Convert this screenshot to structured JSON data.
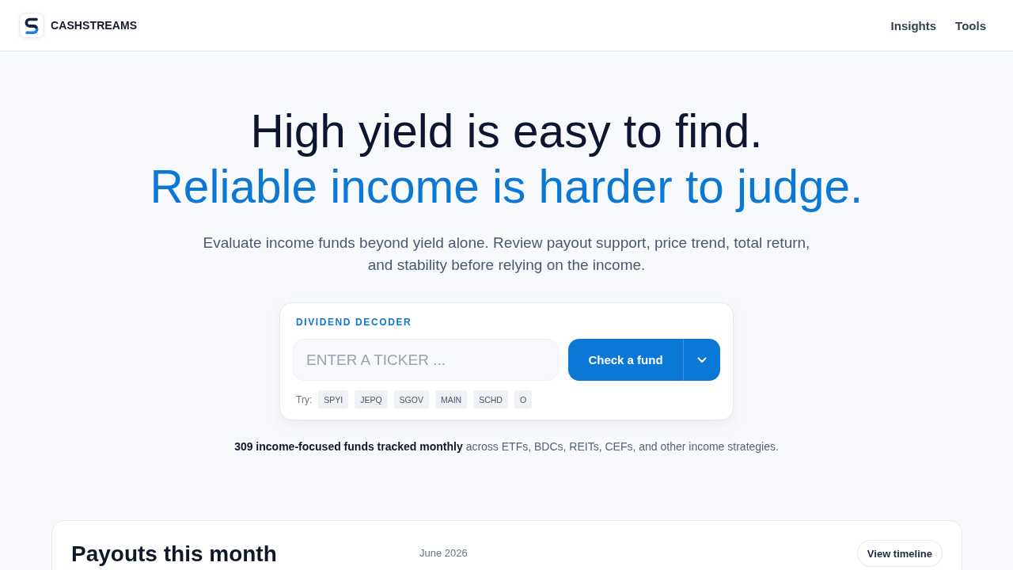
{
  "header": {
    "brand": "CASHSTREAMS",
    "nav": [
      "Insights",
      "Tools"
    ]
  },
  "hero": {
    "headline": "High yield is easy to find.",
    "headline_accent": "Reliable income is harder to judge.",
    "subtitle": "Evaluate income funds beyond yield alone. Review payout support, price trend, total return, and stability before relying on the income."
  },
  "decoder": {
    "label": "DIVIDEND DECODER",
    "placeholder": "ENTER A TICKER ...",
    "button": "Check a fund",
    "try_label": "Try:",
    "suggestions": [
      "SPYI",
      "JEPQ",
      "SGOV",
      "MAIN",
      "SCHD",
      "O"
    ]
  },
  "coverage": "**309 income-focused funds tracked monthly** across ETFs, BDCs, REITs, CEFs, and other income strategies.",
  "payouts": {
    "title": "Payouts this month",
    "month": "June 2026",
    "button": "View timeline"
  }
}
